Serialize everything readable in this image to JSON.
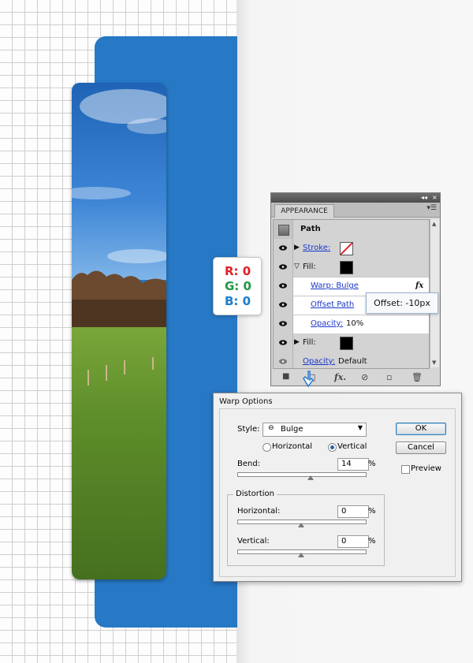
{
  "rgb_badge": {
    "r_label": "R:",
    "r_value": "0",
    "g_label": "G:",
    "g_value": "0",
    "b_label": "B:",
    "b_value": "0"
  },
  "appearance": {
    "tab_label": "APPEARANCE",
    "object_label": "Path",
    "stroke_label": "Stroke:",
    "fill_label": "Fill:",
    "warp_label": "Warp: Bulge",
    "offset_label": "Offset Path",
    "opacity_label": "Opacity:",
    "opacity_value": "10%",
    "fill2_label": "Fill:",
    "opacity2_label": "Opacity:",
    "opacity2_value": "Default",
    "fx_icon": "fx",
    "swatch_color": "#000000"
  },
  "offset_tooltip": "Offset: -10px",
  "warp_dialog": {
    "title": "Warp Options",
    "style_label": "Style:",
    "style_value": "Bulge",
    "horizontal_label": "Horizontal",
    "vertical_label": "Vertical",
    "orientation": "vertical",
    "bend_label": "Bend:",
    "bend_value": "14",
    "percent": "%",
    "distortion_label": "Distortion",
    "horizontal_dist_label": "Horizontal:",
    "horizontal_dist_value": "0",
    "vertical_dist_label": "Vertical:",
    "vertical_dist_value": "0",
    "ok_label": "OK",
    "cancel_label": "Cancel",
    "preview_label": "Preview"
  },
  "colors": {
    "blue": "#2778c5",
    "red": "#e0232a",
    "green": "#239a43",
    "link": "#1a37c9"
  }
}
